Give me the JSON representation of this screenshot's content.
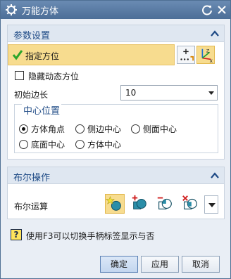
{
  "window": {
    "title": "万能方体"
  },
  "params_panel": {
    "title": "参数设置",
    "specify_orientation_label": "指定方位",
    "hide_dynamic_orientation_label": "隐藏动态方位",
    "initial_side_length_label": "初始边长",
    "initial_side_length_value": "10",
    "center_position": {
      "title": "中心位置",
      "options": [
        "方体角点",
        "侧边中心",
        "侧面中心",
        "底面中心",
        "方体中心"
      ],
      "selected": "方体角点"
    }
  },
  "boolean_panel": {
    "title": "布尔操作",
    "boolean_label": "布尔运算",
    "operations": [
      "none",
      "unite",
      "subtract",
      "intersect"
    ]
  },
  "help_text": "使用F3可以切换手柄标签显示与否",
  "buttons": {
    "ok": "确定",
    "apply": "应用",
    "cancel": "取消"
  },
  "colors": {
    "title_bar": "#5b7ea8",
    "panel_title": "#1f4b86",
    "highlight": "#f7dc8f",
    "check": "#2aa52a"
  }
}
